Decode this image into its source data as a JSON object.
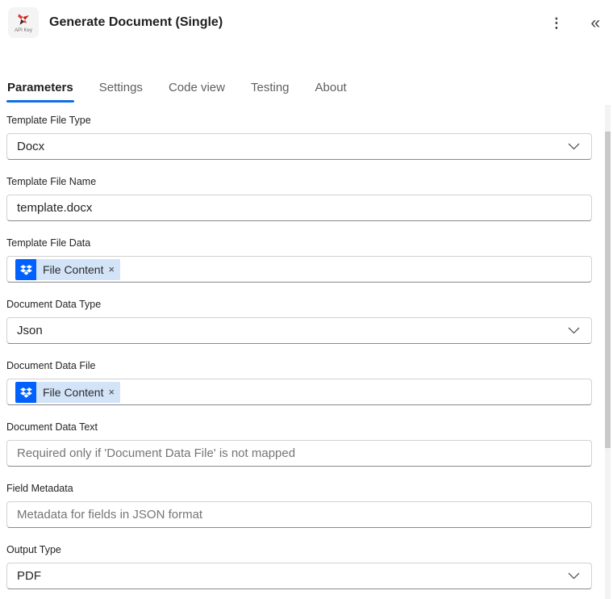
{
  "header": {
    "badge_label": "API Key",
    "title": "Generate Document (Single)"
  },
  "icons": {
    "more": "⋮",
    "collapse": "«"
  },
  "tabs": [
    {
      "label": "Parameters",
      "active": true
    },
    {
      "label": "Settings",
      "active": false
    },
    {
      "label": "Code view",
      "active": false
    },
    {
      "label": "Testing",
      "active": false
    },
    {
      "label": "About",
      "active": false
    }
  ],
  "fields": [
    {
      "label": "Template File Type",
      "type": "dropdown",
      "value": "Docx"
    },
    {
      "label": "Template File Name",
      "type": "text",
      "value": "template.docx"
    },
    {
      "label": "Template File Data",
      "type": "token",
      "token": {
        "source_icon": "dropbox-icon",
        "label": "File Content",
        "remove": "×"
      }
    },
    {
      "label": "Document Data Type",
      "type": "dropdown",
      "value": "Json"
    },
    {
      "label": "Document Data File",
      "type": "token",
      "token": {
        "source_icon": "dropbox-icon",
        "label": "File Content",
        "remove": "×"
      }
    },
    {
      "label": "Document Data Text",
      "type": "text",
      "placeholder": "Required only if 'Document Data File' is not mapped"
    },
    {
      "label": "Field Metadata",
      "type": "text",
      "placeholder": "Metadata for fields in JSON format"
    },
    {
      "label": "Output Type",
      "type": "dropdown",
      "value": "PDF"
    }
  ],
  "colors": {
    "accent": "#1070e0",
    "dropbox_blue": "#0061ff",
    "token_bg": "#d3e3f8"
  }
}
